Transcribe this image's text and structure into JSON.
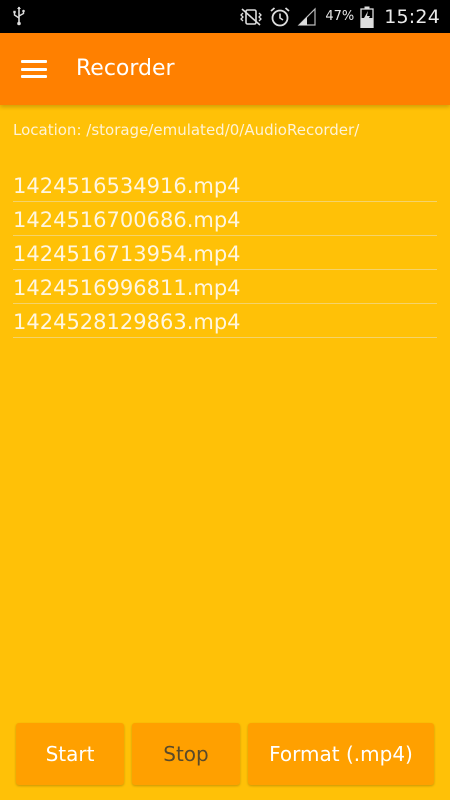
{
  "status_bar": {
    "battery_percent": "47%",
    "time": "15:24",
    "icons": [
      "usb-icon",
      "vibrate-icon",
      "alarm-icon",
      "signal-icon",
      "battery-charging-icon"
    ]
  },
  "app_bar": {
    "title": "Recorder",
    "menu_icon": "hamburger-menu-icon",
    "color": "#FF8000"
  },
  "location_text": "Location: /storage/emulated/0/AudioRecorder/",
  "files": [
    "1424516534916.mp4",
    "1424516700686.mp4",
    "1424516713954.mp4",
    "1424516996811.mp4",
    "1424528129863.mp4"
  ],
  "buttons": {
    "start": "Start",
    "stop": "Stop",
    "format": "Format (.mp4)"
  },
  "colors": {
    "background": "#FFC107",
    "button": "#FFA000",
    "status_bar": "#000000"
  }
}
